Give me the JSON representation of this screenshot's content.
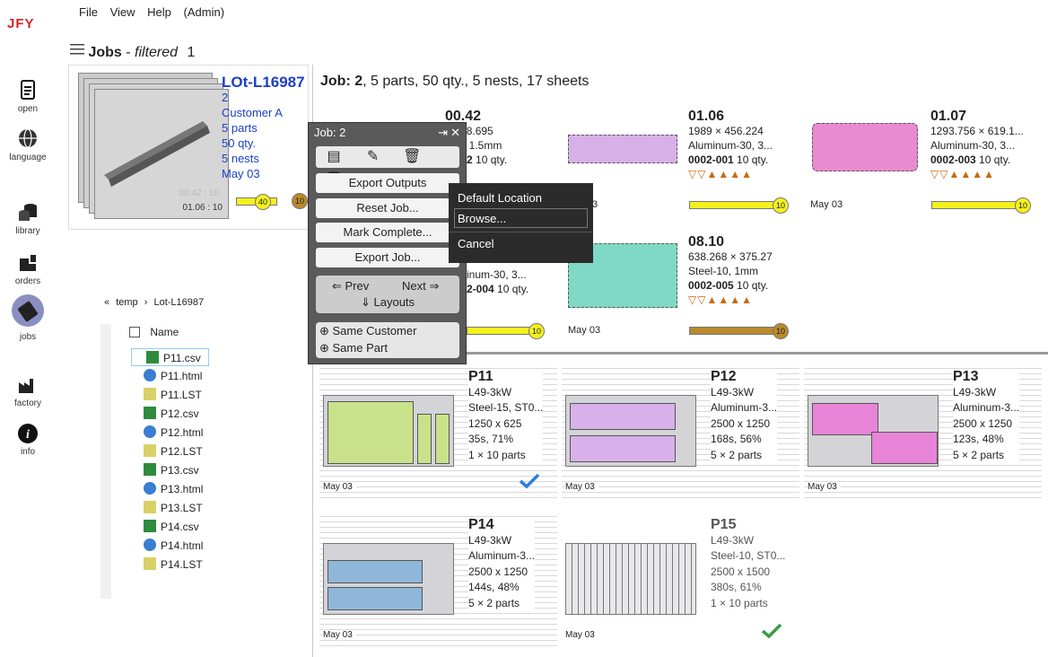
{
  "app": {
    "logo": "JFY"
  },
  "menu": {
    "file": "File",
    "view": "View",
    "help": "Help",
    "admin": "(Admin)"
  },
  "rail": {
    "open": "open",
    "language": "language",
    "library": "library",
    "orders": "orders",
    "jobs": "jobs",
    "factory": "factory",
    "info": "info"
  },
  "header": {
    "title": "Jobs",
    "sep": " - ",
    "filter": "filtered",
    "count": "1"
  },
  "lot": {
    "name": "LOt-L16987",
    "job": "2",
    "customer": "Customer A",
    "parts": "5 parts",
    "qty": "50 qty.",
    "nests": "5 nests",
    "date": "May 03",
    "thumb_ghost": "00.42 : 10",
    "thumb_label": "01.06 : 10",
    "progress_total": "40",
    "progress_badge": "10"
  },
  "job_summary": {
    "label": "Job:",
    "num": "2",
    "rest": ", 5 parts, 50 qty., 5 nests, 17 sheets"
  },
  "parts": [
    {
      "name": "00.42",
      "dims": "× 138.695",
      "mat": "l-15, 1.5mm",
      "order": "2-002",
      "qty": " 10 qty.",
      "date": ""
    },
    {
      "name": "01.06",
      "dims": "1989 × 456.224",
      "mat": "Aluminum-30, 3...",
      "order": "0002-001",
      "qty": " 10 qty.",
      "date": "3"
    },
    {
      "name": "01.07",
      "dims": "1293.756 × 619.1...",
      "mat": "Aluminum-30, 3...",
      "order": "0002-003",
      "qty": " 10 qty.",
      "date": "May 03"
    },
    {
      "name": "",
      "dims": "",
      "mat": "inum-30, 3...",
      "order": "2-004",
      "qty": " 10 qty.",
      "date": ""
    },
    {
      "name": "08.10",
      "dims": "638.268 × 375.27",
      "mat": "Steel-10, 1mm",
      "order": "0002-005",
      "qty": " 10 qty.",
      "date": "May 03"
    }
  ],
  "progress_values": {
    "badge": "10",
    "part_fill": 1.0
  },
  "nests": [
    {
      "name": "P11",
      "machine": "L49-3kW",
      "mat": "Steel-15, ST0...",
      "size": "1250 x 625",
      "time": "35s, 71%",
      "parts": "1 × 10 parts",
      "date": "May 03"
    },
    {
      "name": "P12",
      "machine": "L49-3kW",
      "mat": "Aluminum-3...",
      "size": "2500 x 1250",
      "time": "168s, 56%",
      "parts": "5 × 2 parts",
      "date": "May 03"
    },
    {
      "name": "P13",
      "machine": "L49-3kW",
      "mat": "Aluminum-3...",
      "size": "2500 x 1250",
      "time": "123s, 48%",
      "parts": "5 × 2 parts",
      "date": "May 03"
    },
    {
      "name": "P14",
      "machine": "L49-3kW",
      "mat": "Aluminum-3...",
      "size": "2500 x 1250",
      "time": "144s, 48%",
      "parts": "5 × 2 parts",
      "date": "May 03"
    },
    {
      "name": "P15",
      "machine": "L49-3kW",
      "mat": "Steel-10, ST0...",
      "size": "2500 x 1500",
      "time": "380s, 61%",
      "parts": "1 × 10 parts",
      "date": "May 03"
    }
  ],
  "job_panel": {
    "title": "Job: 2",
    "export_outputs": "Export Outputs",
    "reset_job": "Reset Job...",
    "mark_complete": "Mark Complete...",
    "export_job": "Export Job...",
    "prev": "Prev",
    "next": "Next",
    "layouts": "Layouts",
    "same_customer": "Same Customer",
    "same_part": "Same Part"
  },
  "context_menu": {
    "default_location": "Default Location",
    "browse": "Browse...",
    "cancel": "Cancel"
  },
  "explorer": {
    "crumb_root": "temp",
    "crumb_folder": "Lot-L16987",
    "col_name": "Name",
    "files": [
      "P11.csv",
      "P11.html",
      "P11.LST",
      "P12.csv",
      "P12.html",
      "P12.LST",
      "P13.csv",
      "P13.html",
      "P13.LST",
      "P14.csv",
      "P14.html",
      "P14.LST"
    ]
  },
  "colors": {
    "accent_blue": "#1b3fc4",
    "progress_yellow": "#f4f11c",
    "progress_bronze": "#b88a2a",
    "check_blue": "#2b7de0",
    "check_green": "#3a9a48"
  }
}
